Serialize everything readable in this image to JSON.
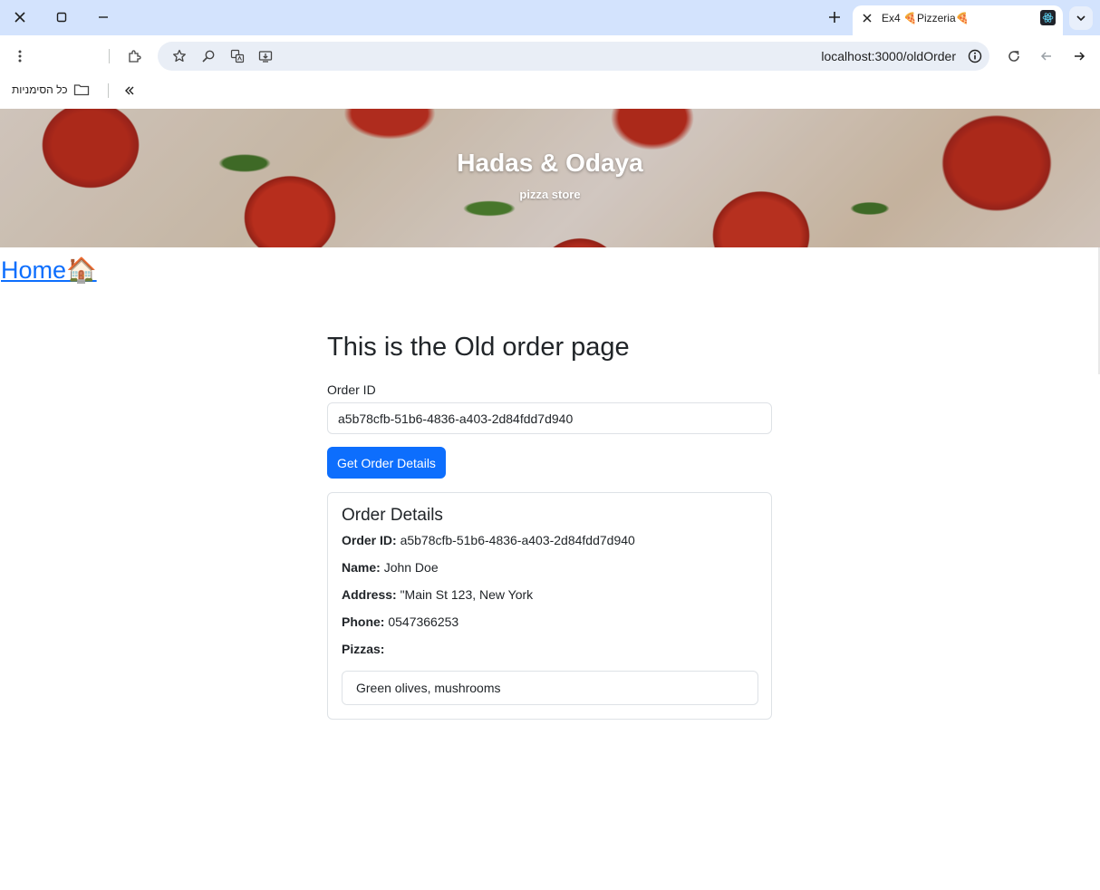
{
  "browser": {
    "tab": {
      "title": "Ex4 🍕Pizzeria🍕",
      "favicon": "react-icon"
    },
    "address_bar": {
      "url": "localhost:3000/oldOrder"
    },
    "bookmarks_bar": {
      "all_bookmarks_label": "כל הסימניות"
    },
    "window_controls": [
      "close-icon",
      "maximize-icon",
      "minimize-icon"
    ]
  },
  "hero": {
    "title": "Hadas & Odaya",
    "subtitle": "pizza store"
  },
  "nav": {
    "home_label": "Home🏠"
  },
  "page": {
    "title": "This is the Old order page",
    "order_id_label": "Order ID",
    "order_id_value": "a5b78cfb-51b6-4836-a403-2d84fdd7d940",
    "get_button_label": "Get Order Details"
  },
  "order_details": {
    "heading": "Order Details",
    "fields": [
      {
        "label": "Order ID:",
        "value": "a5b78cfb-51b6-4836-a403-2d84fdd7d940"
      },
      {
        "label": "Name:",
        "value": "John Doe"
      },
      {
        "label": "Address:",
        "value": "\"Main St 123, New York"
      },
      {
        "label": "Phone:",
        "value": "0547366253"
      }
    ],
    "pizzas_label": "Pizzas:",
    "pizzas": [
      "Green olives, mushrooms"
    ]
  },
  "colors": {
    "accent": "#0d6efd",
    "tabstrip": "#d3e3fd",
    "omnibox": "#e9eef6",
    "border": "#dee2e6"
  }
}
